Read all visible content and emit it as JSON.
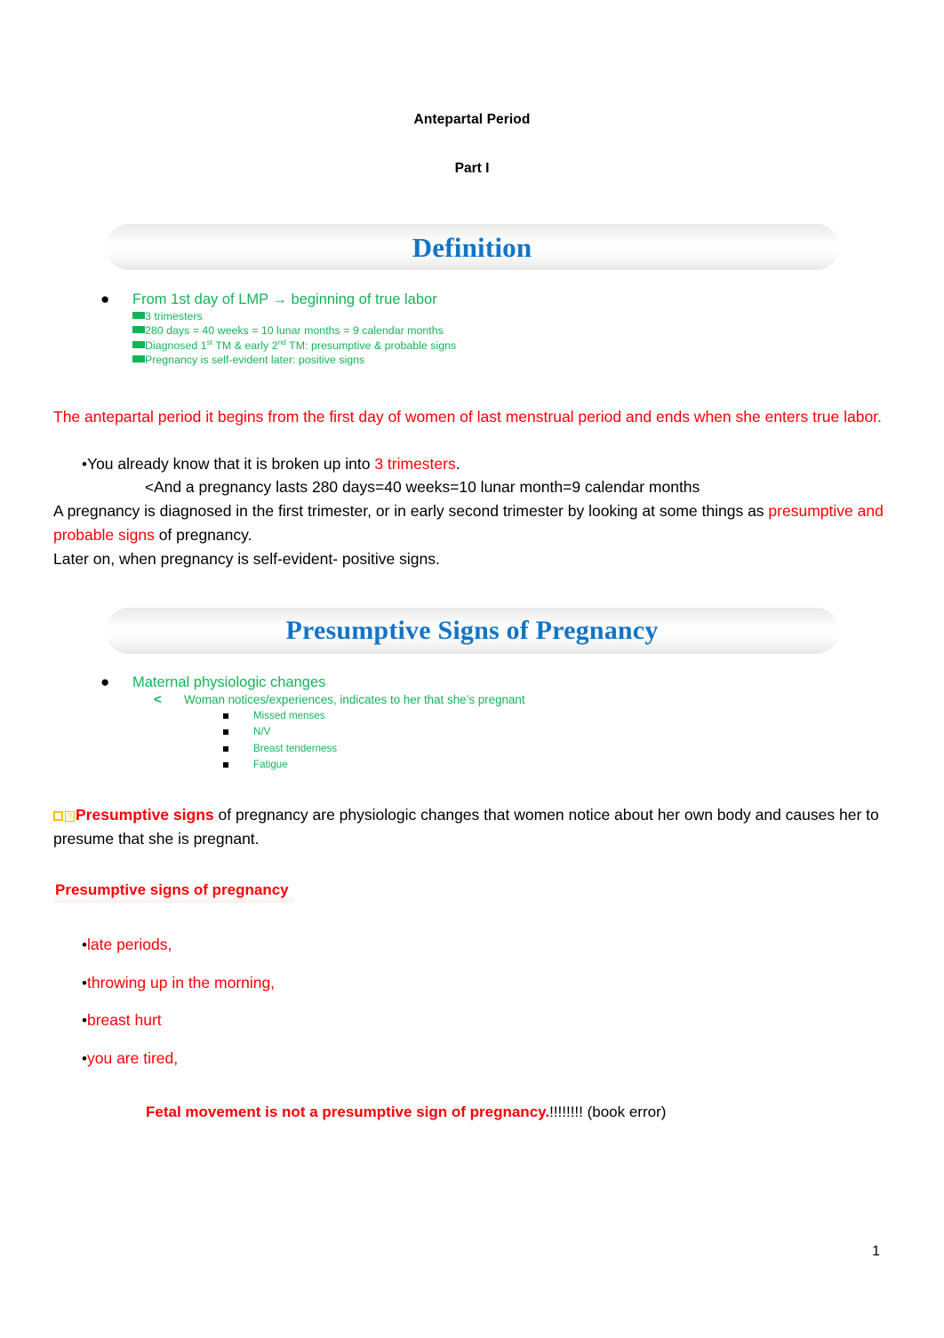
{
  "document": {
    "title": "Antepartal Period",
    "subtitle": "Part I",
    "page_number": "1"
  },
  "colors": {
    "heading_blue": "#1474c4",
    "accent_red": "#fb0007",
    "accent_green": "#14b358",
    "yellow_box": "#ffc000"
  },
  "sections": [
    {
      "banner": "Definition",
      "slide_list": {
        "level1": "From 1st day of LMP → beginning of true labor",
        "level2": [
          "3 trimesters",
          "280 days = 40 weeks = 10 lunar months = 9 calendar months",
          "Diagnosed 1st TM & early 2nd TM: presumptive & probable signs",
          "Pregnancy is self-evident later: positive signs"
        ],
        "level2_rich": [
          {
            "text": "3 trimesters"
          },
          {
            "text": "280 days = 40 weeks = 10 lunar months = 9 calendar months"
          },
          {
            "pre": "Diagnosed 1",
            "sup1": "st",
            "mid": " TM & early 2",
            "sup2": "nd",
            "post": " TM: presumptive & probable signs"
          },
          {
            "text": "Pregnancy is self-evident later: positive signs"
          }
        ]
      },
      "notes": {
        "red_paragraph": "The antepartal period it begins from the first day of women of last menstrual period and ends when she enters true labor.",
        "bullet_1_pre": "You already know that it is broken up into ",
        "bullet_1_red": "3 trimesters",
        "bullet_1_post": ".",
        "sub_bullet_marker": "<",
        "sub_bullet_text": "And a pregnancy lasts 280 days=40 weeks=10 lunar month=9 calendar months",
        "para_2_pre": "A pregnancy is diagnosed in the first trimester, or in early second trimester by looking at some things as ",
        "para_2_red": "presumptive and probable signs",
        "para_2_post": " of pregnancy.",
        "para_3": "Later on, when pregnancy is self-evident- positive signs."
      }
    },
    {
      "banner": "Presumptive Signs of Pregnancy",
      "slide_list": {
        "level1": "Maternal physiologic changes",
        "level2_marker": "<",
        "level2": "Woman notices/experiences, indicates to her that she’s pregnant",
        "level3": [
          "Missed menses",
          "N/V",
          "Breast tenderness",
          "Fatigue"
        ]
      },
      "notes": {
        "glyph_missing": "?",
        "presumptive_bold": "Presumptive signs",
        "presumptive_rest": " of pregnancy are physiologic changes that women notice about her own body and causes her to presume that she is pregnant.",
        "sub_heading": "Presumptive signs of pregnancy",
        "red_bullets": [
          "late periods,",
          "throwing up in the morning,",
          "breast hurt",
          "you are tired,"
        ],
        "final_note_red": "Fetal movement is not a presumptive sign of pregnancy",
        "final_note_red_period": ".",
        "final_note_black": "!!!!!!!! (book error)"
      }
    }
  ],
  "markers": {
    "round_bullet": "•",
    "angle_bullet": "<"
  }
}
